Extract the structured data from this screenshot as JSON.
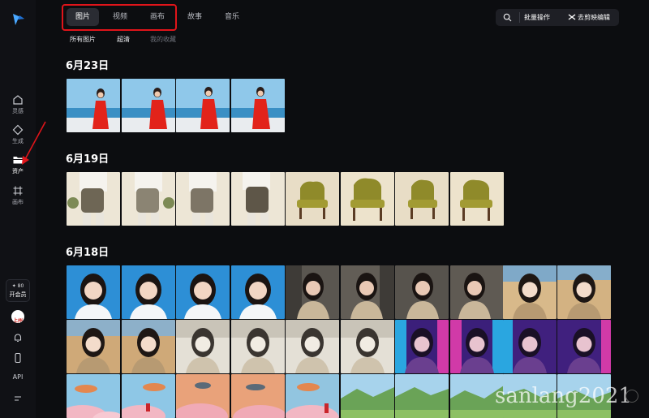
{
  "nav": {
    "tabs": [
      {
        "label": "图片"
      },
      {
        "label": "视频"
      },
      {
        "label": "画布"
      },
      {
        "label": "故事"
      },
      {
        "label": "音乐"
      }
    ],
    "subtabs": [
      {
        "label": "所有图片"
      },
      {
        "label": "超清"
      },
      {
        "label": "我的收藏"
      }
    ]
  },
  "toolbar": {
    "batch_label": "批量操作",
    "edit_label": "去剪映编辑"
  },
  "sidebar": {
    "items": [
      {
        "label": "灵感"
      },
      {
        "label": "生成"
      },
      {
        "label": "资产"
      },
      {
        "label": "画布"
      }
    ],
    "credits": "✦ 80",
    "vip_label": "开会员",
    "avatar_text": "上州",
    "api_label": "API"
  },
  "sections": [
    {
      "date": "6月23日"
    },
    {
      "date": "6月19日"
    },
    {
      "date": "6月18日"
    }
  ],
  "watermark": "sanlang2021",
  "colors": {
    "accent_red": "#e0141a",
    "background": "#0c0d10",
    "sidebar": "#101115"
  }
}
